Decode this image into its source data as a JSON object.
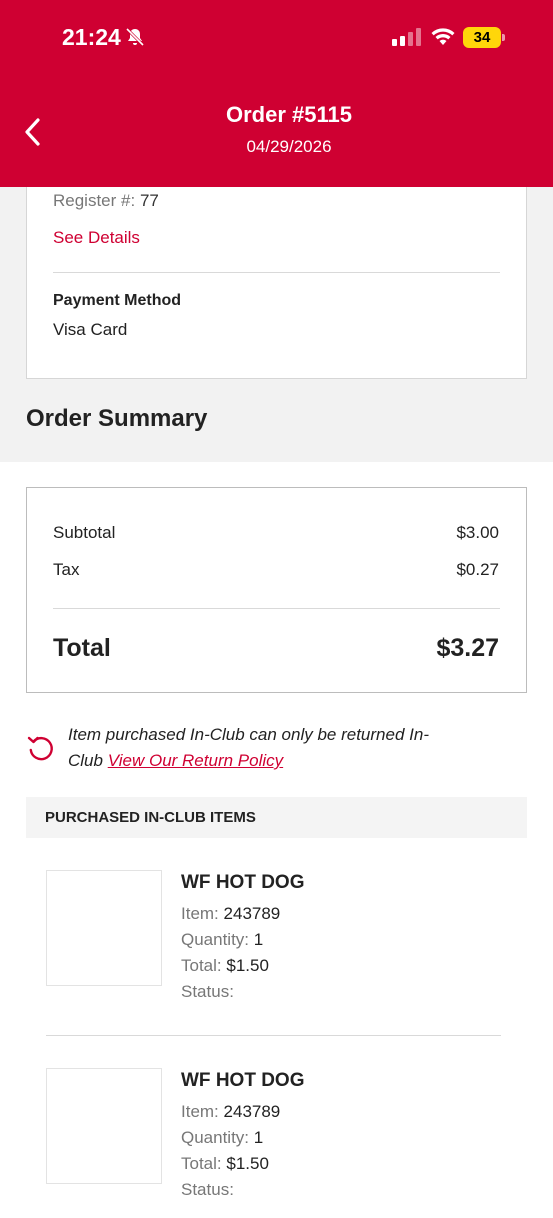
{
  "status_bar": {
    "time": "21:24",
    "battery": "34"
  },
  "header": {
    "title": "Order #5115",
    "date": "04/29/2026"
  },
  "order_info": {
    "register_label": "Register #:",
    "register_value": "77",
    "see_details": "See Details",
    "payment_label": "Payment Method",
    "payment_value": "Visa Card"
  },
  "summary": {
    "heading": "Order Summary",
    "subtotal_label": "Subtotal",
    "subtotal_value": "$3.00",
    "tax_label": "Tax",
    "tax_value": "$0.27",
    "total_label": "Total",
    "total_value": "$3.27"
  },
  "return_notice": {
    "text": "Item purchased In-Club can only be returned In-Club",
    "link": "View Our Return Policy"
  },
  "items_section": {
    "heading": "PURCHASED IN-CLUB ITEMS",
    "items": [
      {
        "name": "WF HOT DOG",
        "item_label": "Item:",
        "item_value": "243789",
        "qty_label": "Quantity:",
        "qty_value": "1",
        "total_label": "Total:",
        "total_value": "$1.50",
        "status_label": "Status:"
      },
      {
        "name": "WF HOT DOG",
        "item_label": "Item:",
        "item_value": "243789",
        "qty_label": "Quantity:",
        "qty_value": "1",
        "total_label": "Total:",
        "total_value": "$1.50",
        "status_label": "Status:"
      }
    ]
  },
  "colors": {
    "brand": "#cf0032",
    "battery": "#ffd60a"
  }
}
